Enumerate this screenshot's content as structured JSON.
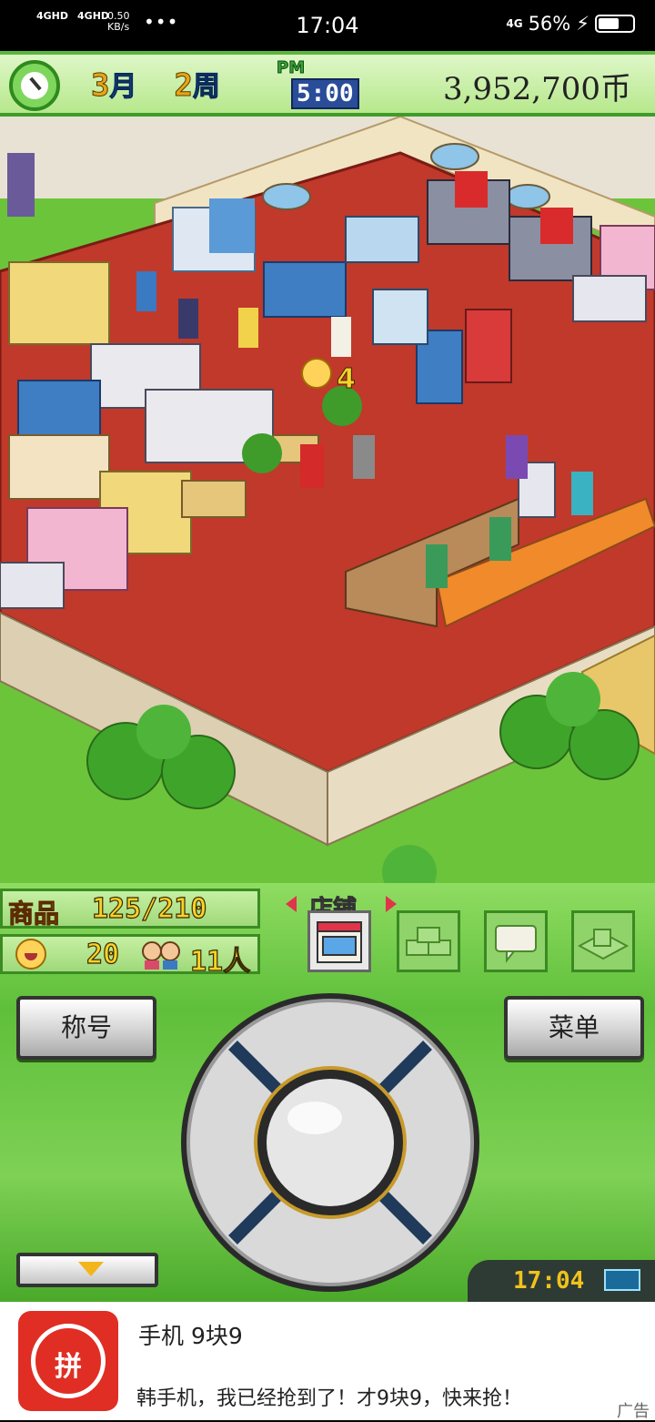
{
  "status_bar": {
    "network_1": "4GHD",
    "network_2": "4GHD",
    "speed": "0.50",
    "speed_unit": "KB/s",
    "dots": "•••",
    "time": "17:04",
    "signal": "4G",
    "battery": "56%"
  },
  "top_bar": {
    "month": "3",
    "month_unit": "月",
    "week": "2",
    "week_unit": "周",
    "ampm": "PM",
    "game_time": "5:00",
    "money": "3,952,700币"
  },
  "stats": {
    "goods_label": "商品",
    "goods_value": "125/210",
    "satisfaction_value": "20",
    "visitors_value": "11人"
  },
  "tabs": {
    "current_label": "店铺"
  },
  "buttons": {
    "title_label": "称号",
    "menu_label": "菜单"
  },
  "device_clock": "17:04",
  "ad": {
    "icon_text": "拼",
    "title": "手机 9块9",
    "description": "韩手机，我已经抢到了！才9块9，快来抢！",
    "tag": "广告"
  },
  "colors": {
    "floor": "#c0392b",
    "grass": "#6cc43a",
    "panel": "#5fbf3a",
    "accent_yellow": "#f2b51c"
  }
}
